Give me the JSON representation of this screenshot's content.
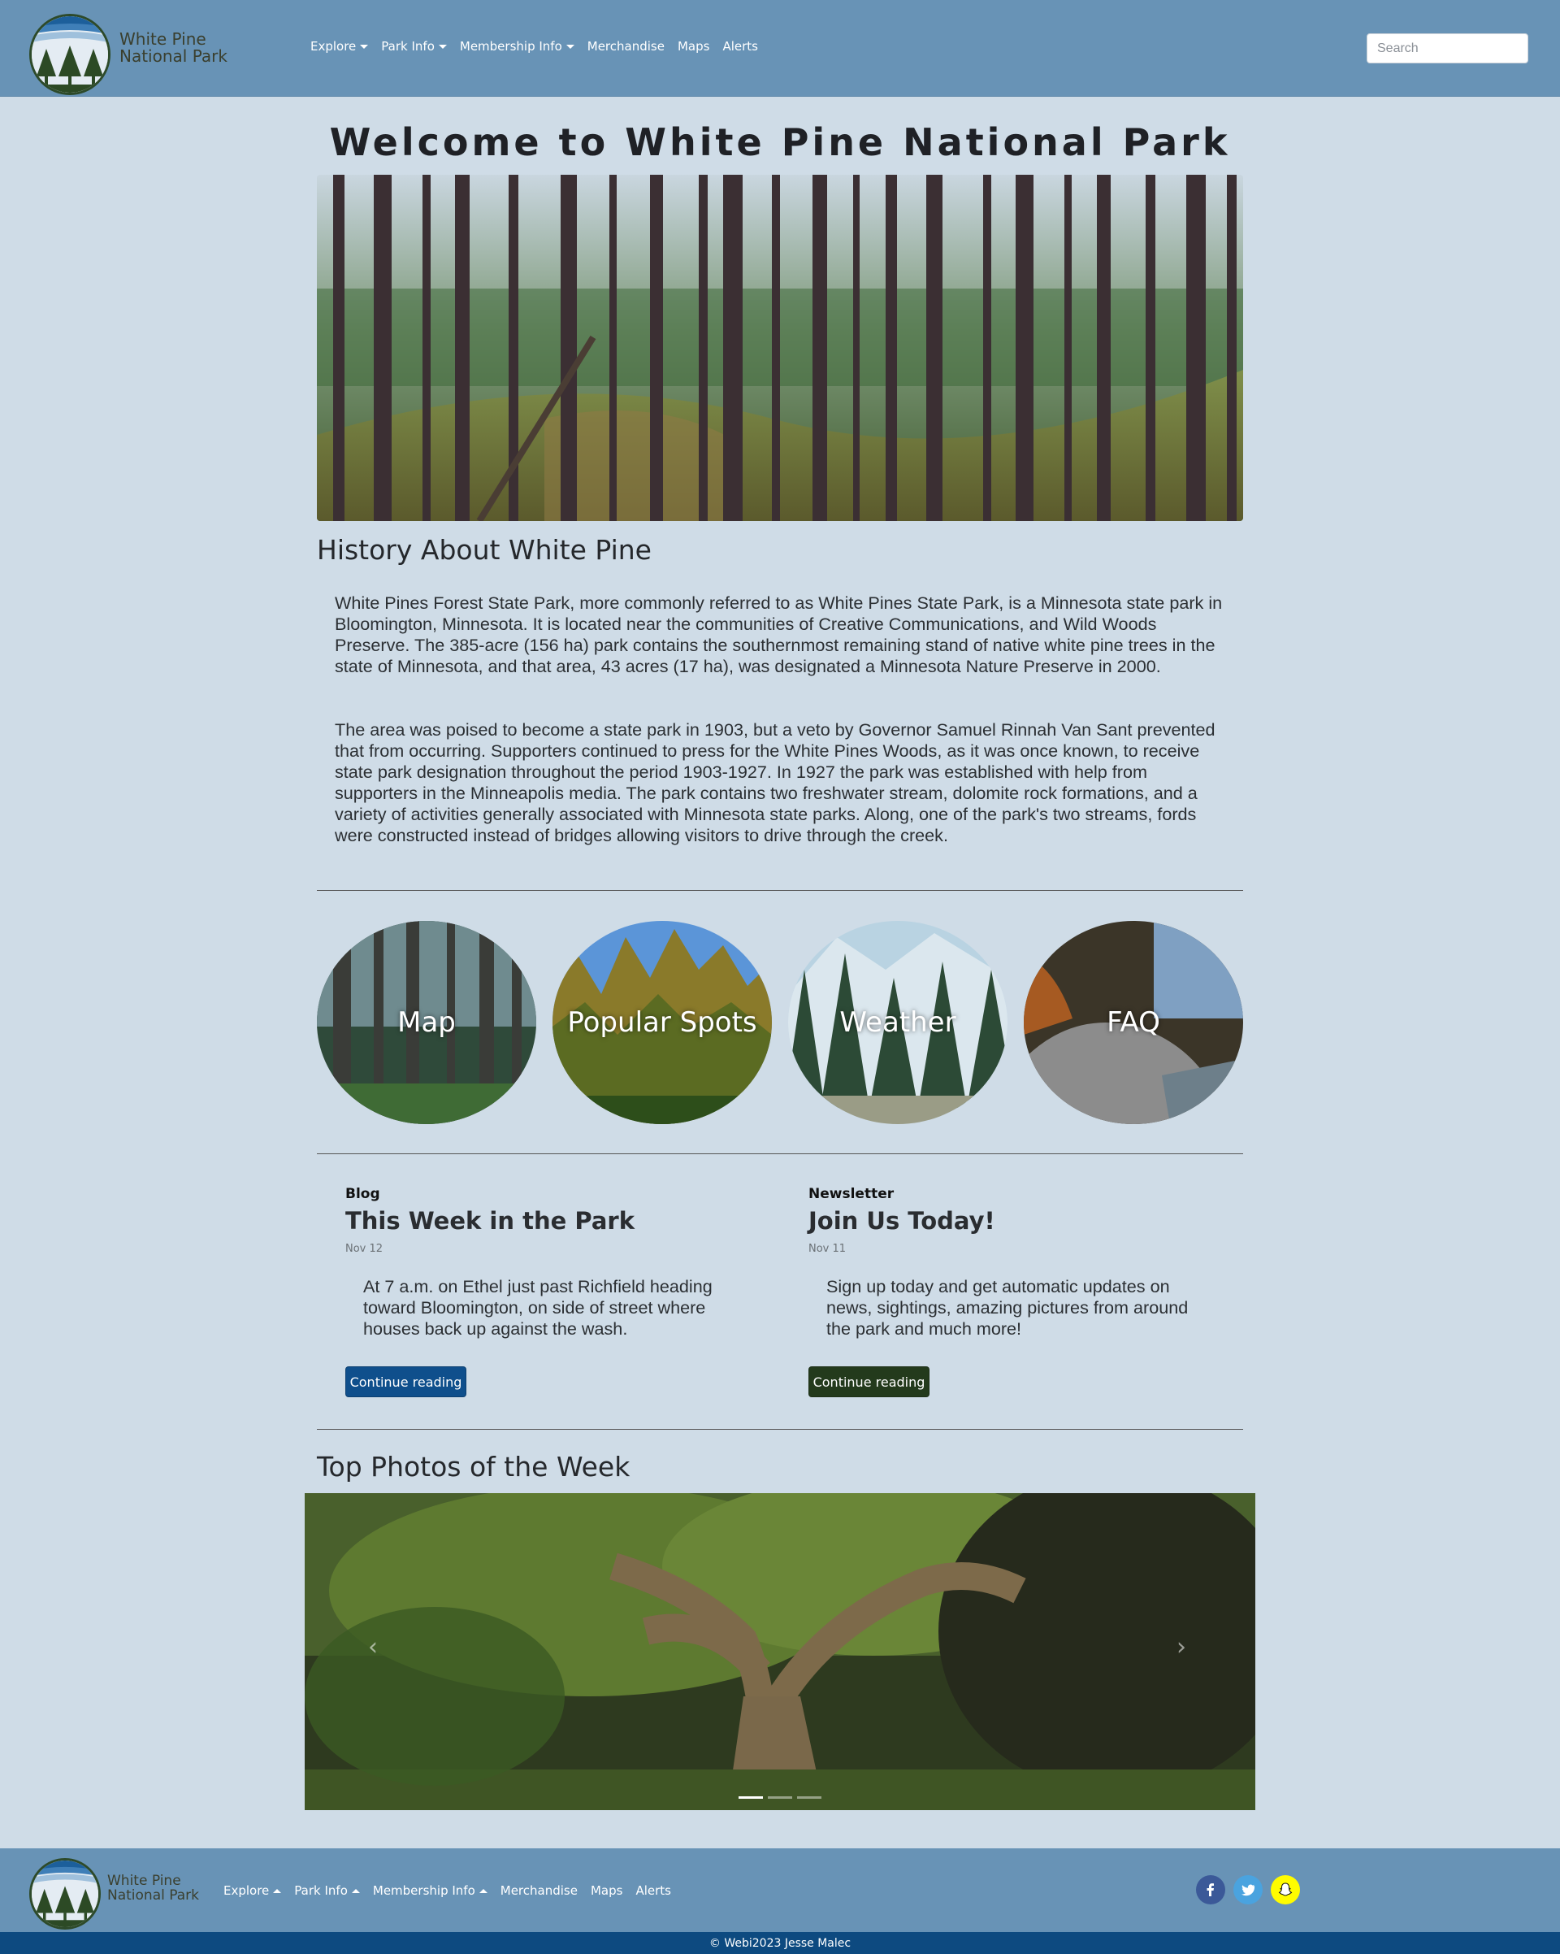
{
  "brand": {
    "line1": "White Pine",
    "line2": "National Park"
  },
  "nav": [
    {
      "label": "Explore",
      "dropdown": true
    },
    {
      "label": "Park Info",
      "dropdown": true
    },
    {
      "label": "Membership Info",
      "dropdown": true
    },
    {
      "label": "Merchandise",
      "dropdown": false
    },
    {
      "label": "Maps",
      "dropdown": false
    },
    {
      "label": "Alerts",
      "dropdown": false
    }
  ],
  "search": {
    "placeholder": "Search"
  },
  "page_title": "Welcome to White Pine National Park",
  "history": {
    "heading": "History About White Pine",
    "paragraphs": [
      "White Pines Forest State Park, more commonly referred to as White Pines State Park, is a Minnesota state park in Bloomington, Minnesota. It is located near the communities of Creative Communications, and Wild Woods Preserve. The 385-acre (156 ha) park contains the southernmost remaining stand of native white pine trees in the state of Minnesota, and that area, 43 acres (17 ha), was designated a Minnesota Nature Preserve in 2000.",
      "The area was poised to become a state park in 1903, but a veto by Governor Samuel Rinnah Van Sant prevented that from occurring. Supporters continued to press for the White Pines Woods, as it was once known, to receive state park designation throughout the period 1903-1927. In 1927 the park was established with help from supporters in the Minneapolis media. The park contains two freshwater stream, dolomite rock formations, and a variety of activities generally associated with Minnesota state parks. Along, one of the park's two streams, fords were constructed instead of bridges allowing visitors to drive through the creek."
    ]
  },
  "circles": [
    "Map",
    "Popular Spots",
    "Weather",
    "FAQ"
  ],
  "cards": [
    {
      "kicker": "Blog",
      "title": "This Week in the Park",
      "date": "Nov 12",
      "body": "At 7 a.m. on Ethel just past Richfield heading toward Bloomington, on side of street where houses back up against the wash.",
      "button": "Continue reading",
      "button_color": "#0f4f8c"
    },
    {
      "kicker": "Newsletter",
      "title": "Join Us Today!",
      "date": "Nov 11",
      "body": "Sign up today and get automatic updates on news, sightings, amazing pictures from around the park and much more!",
      "button": "Continue reading",
      "button_color": "#233a1c"
    }
  ],
  "photos_heading": "Top Photos of the Week",
  "carousel": {
    "prev": "‹",
    "next": "›",
    "slide_count": 3,
    "active_slide": 1
  },
  "social": [
    {
      "icon": "facebook-icon",
      "glyph": "f",
      "color": "#3b5998"
    },
    {
      "icon": "twitter-icon",
      "glyph": "t",
      "color": "#4aa3df"
    },
    {
      "icon": "snapchat-icon",
      "glyph": "s",
      "color": "#fffc00"
    }
  ],
  "copyright": "© Webi2023 Jesse Malec",
  "colors": {
    "nav_bg": "#6893b6",
    "page_bg": "#cfdce7",
    "copyright_bg": "#0d4a80"
  }
}
